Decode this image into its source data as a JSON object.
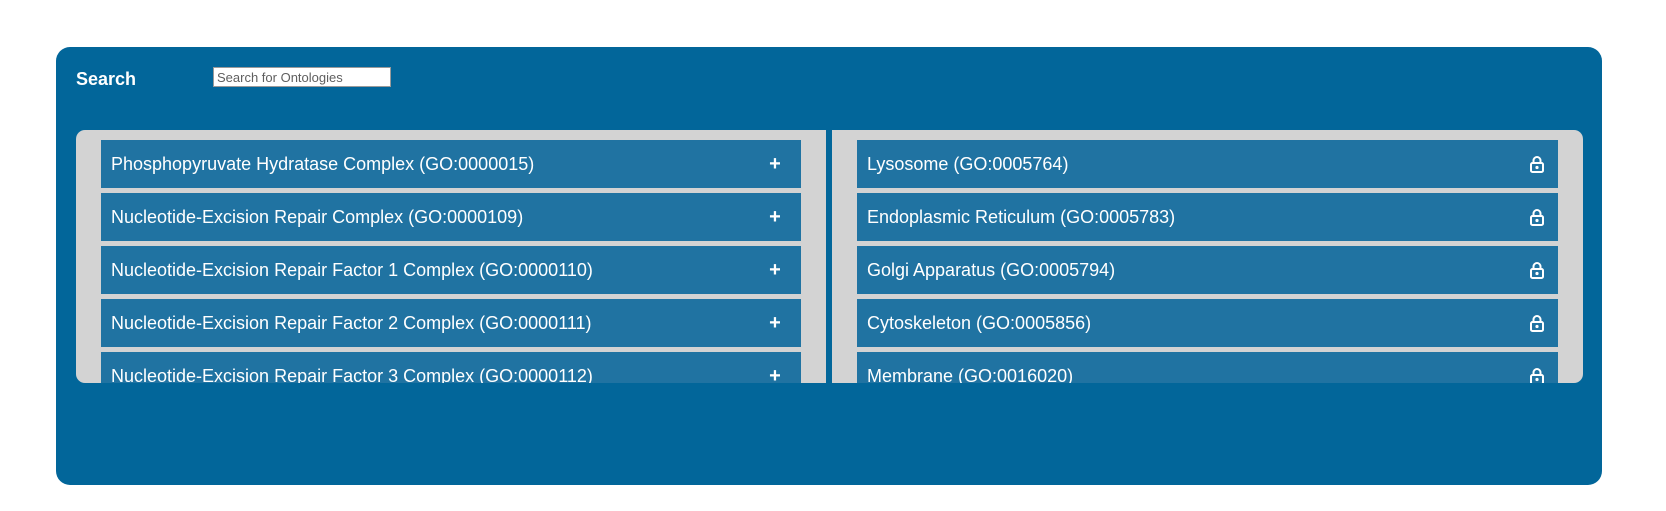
{
  "search": {
    "label": "Search",
    "placeholder": "Search for Ontologies",
    "value": ""
  },
  "available_list": {
    "action_icon": "plus-icon",
    "action_glyph": "+",
    "items": [
      {
        "label": "Phosphopyruvate Hydratase Complex (GO:0000015)"
      },
      {
        "label": "Nucleotide-Excision Repair Complex (GO:0000109)"
      },
      {
        "label": "Nucleotide-Excision Repair Factor 1 Complex (GO:0000110)"
      },
      {
        "label": "Nucleotide-Excision Repair Factor 2 Complex (GO:0000111)"
      },
      {
        "label": "Nucleotide-Excision Repair Factor 3 Complex (GO:0000112)"
      }
    ]
  },
  "selected_list": {
    "action_icon": "lock-icon",
    "items": [
      {
        "label": "Lysosome (GO:0005764)"
      },
      {
        "label": "Endoplasmic Reticulum (GO:0005783)"
      },
      {
        "label": "Golgi Apparatus (GO:0005794)"
      },
      {
        "label": "Cytoskeleton (GO:0005856)"
      },
      {
        "label": "Membrane (GO:0016020)"
      }
    ]
  },
  "colors": {
    "panel": "#02669a",
    "item": "#2073a2",
    "list_background": "#d3d3d3",
    "text": "#ffffff"
  }
}
